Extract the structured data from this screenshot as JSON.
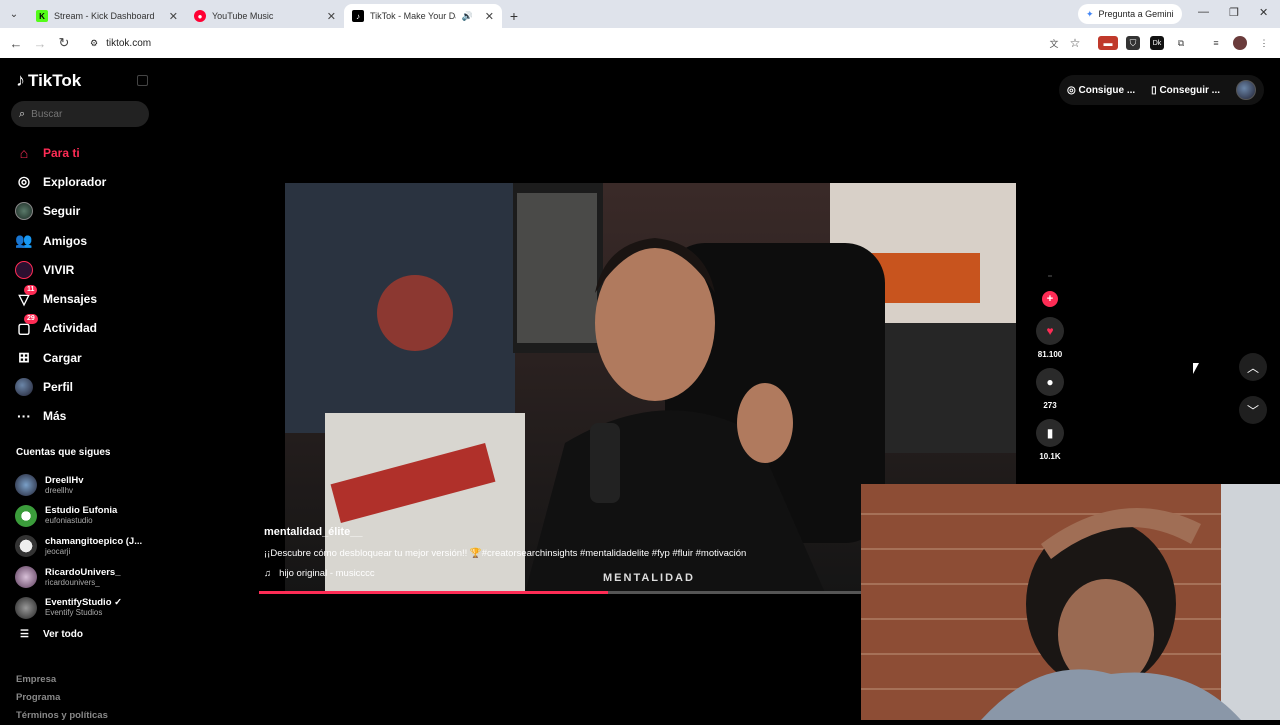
{
  "browser": {
    "tabs": [
      {
        "title": "Stream - Kick Dashboard",
        "icon": "kick-icon",
        "color": "#53fc18"
      },
      {
        "title": "YouTube Music",
        "icon": "youtube-music-icon",
        "color": "#ff0033"
      },
      {
        "title": "TikTok - Make Your Day",
        "icon": "tiktok-icon",
        "color": "#000000"
      }
    ],
    "gemini_label": "Pregunta a Gemini",
    "url": "tiktok.com"
  },
  "tiktok": {
    "logo": "TikTok",
    "search_placeholder": "Buscar",
    "nav": [
      {
        "label": "Para ti",
        "icon": "home-icon"
      },
      {
        "label": "Explorador",
        "icon": "compass-icon"
      },
      {
        "label": "Seguir",
        "icon": "following-avatar-icon"
      },
      {
        "label": "Amigos",
        "icon": "friends-icon"
      },
      {
        "label": "VIVIR",
        "icon": "live-icon"
      },
      {
        "label": "Mensajes",
        "icon": "messages-icon",
        "badge": "11"
      },
      {
        "label": "Actividad",
        "icon": "activity-icon",
        "badge": "29"
      },
      {
        "label": "Cargar",
        "icon": "upload-icon"
      },
      {
        "label": "Perfil",
        "icon": "profile-avatar-icon"
      },
      {
        "label": "Más",
        "icon": "more-icon"
      }
    ],
    "following_title": "Cuentas que sigues",
    "following": [
      {
        "name": "DreellHv",
        "handle": "dreellhv"
      },
      {
        "name": "Estudio Eufonia",
        "handle": "eufoniastudio"
      },
      {
        "name": "chamangitoepico (J...",
        "handle": "jeocarji"
      },
      {
        "name": "RicardoUnivers_",
        "handle": "ricardounivers_"
      },
      {
        "name": "EventifyStudio ✓",
        "handle": "Eventify Studios"
      }
    ],
    "see_all": "Ver todo",
    "footer": [
      "Empresa",
      "Programa",
      "Términos y políticas"
    ],
    "top_buttons": [
      "Consigue ...",
      "Conseguir ..."
    ],
    "video": {
      "username": "mentalidad_élite__",
      "description": "¡¡Descubre cómo desbloquear tu mejor versión!! 🏆#creatorsearchinsights #mentalidadelite #fyp #fluir #motivación",
      "music": "hijo original - musicccc",
      "watermark": "MENTALIDAD",
      "progress": 0.58
    },
    "actions": {
      "likes": "81.100",
      "comments": "273",
      "saves": "10.1K"
    }
  },
  "colors": {
    "accent": "#fe2c55"
  }
}
